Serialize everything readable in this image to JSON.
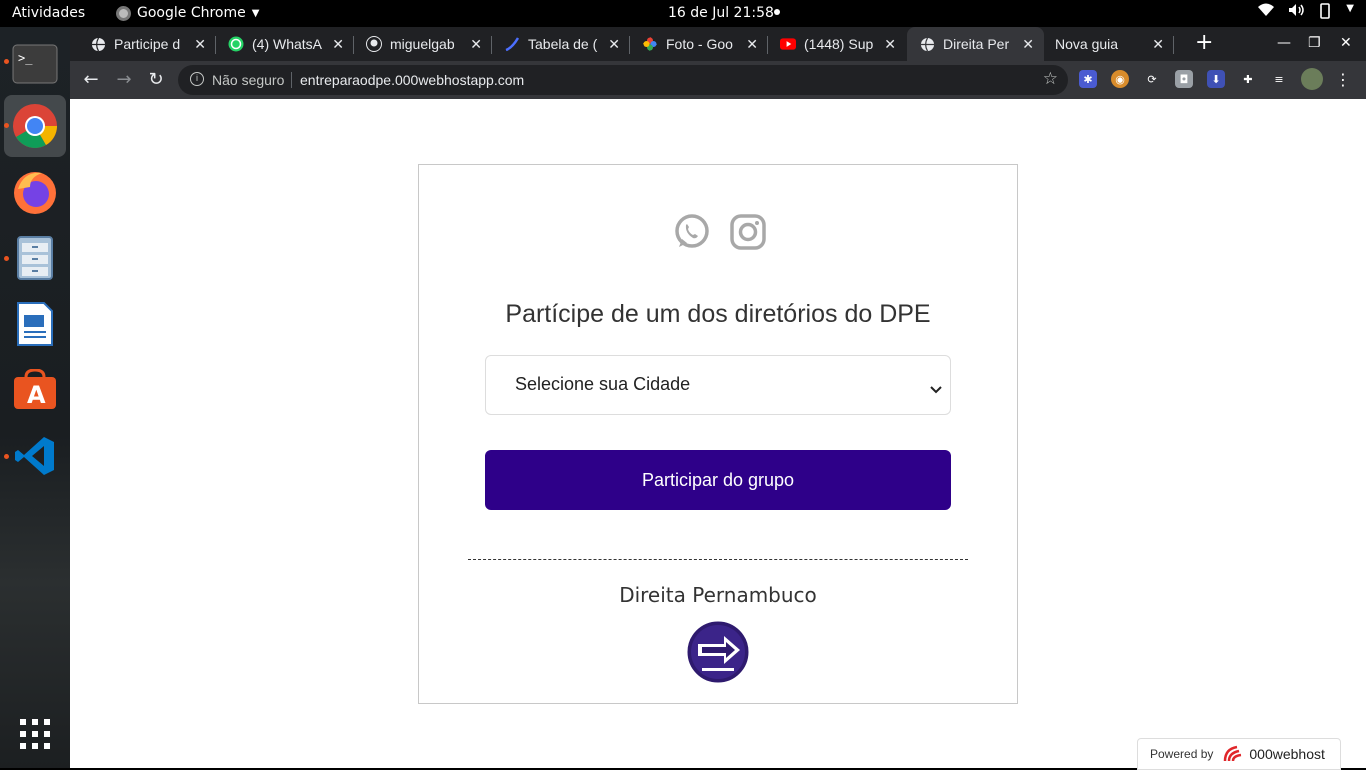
{
  "system": {
    "activities": "Atividades",
    "app_name": "Google Chrome",
    "clock": "16 de Jul  21:58"
  },
  "tabs": [
    {
      "title": "Participe d",
      "icon": "globe-icon"
    },
    {
      "title": "(4) WhatsA",
      "icon": "whatsapp-icon"
    },
    {
      "title": "miguelgab",
      "icon": "github-icon"
    },
    {
      "title": "Tabela de (",
      "icon": "tabela-icon"
    },
    {
      "title": "Foto - Goo",
      "icon": "google-photos-icon"
    },
    {
      "title": "(1448) Sup",
      "icon": "youtube-icon"
    },
    {
      "title": "Direita Per",
      "icon": "globe-icon",
      "active": true
    },
    {
      "title": "Nova guia",
      "icon": ""
    }
  ],
  "omnibox": {
    "security": "Não seguro",
    "url": "entreparaodpe.000webhostapp.com"
  },
  "page": {
    "heading": "Partícipe de um dos diretórios do DPE",
    "select_value": "Selecione sua Cidade",
    "join_button": "Participar do grupo",
    "brand": "Direita Pernambuco",
    "powered_by": "Powered by",
    "host_brand": "000webhost"
  },
  "colors": {
    "button": "#2e0089",
    "chrome_dark": "#202124",
    "chrome_toolbar": "#35363a"
  }
}
